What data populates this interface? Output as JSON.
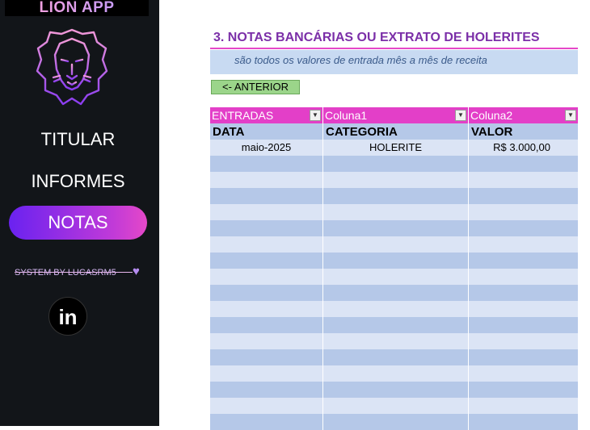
{
  "sidebar": {
    "app_title": "LION APP",
    "logo_icon": "lion-head-icon",
    "nav": [
      {
        "label": "TITULAR",
        "active": false
      },
      {
        "label": "INFORMES",
        "active": false
      },
      {
        "label": "NOTAS",
        "active": true
      }
    ],
    "credit": "SYSTEM BY LUCASRM5",
    "credit_icon": "heart-icon",
    "linkedin_label": "in"
  },
  "main": {
    "title": "3. NOTAS BANCÁRIAS OU EXTRATO DE HOLERITES",
    "subtitle": "são todos os valores de entrada mês a mês de receita",
    "back_button": "<- ANTERIOR"
  },
  "table": {
    "filter_headers": [
      "ENTRADAS",
      "Coluna1",
      "Coluna2"
    ],
    "columns": [
      "DATA",
      "CATEGORIA",
      "VALOR"
    ],
    "rows": [
      [
        "maio-2025",
        "HOLERITE",
        "R$ 3.000,00"
      ],
      [
        "",
        "",
        ""
      ],
      [
        "",
        "",
        ""
      ],
      [
        "",
        "",
        ""
      ],
      [
        "",
        "",
        ""
      ],
      [
        "",
        "",
        ""
      ],
      [
        "",
        "",
        ""
      ],
      [
        "",
        "",
        ""
      ],
      [
        "",
        "",
        ""
      ],
      [
        "",
        "",
        ""
      ],
      [
        "",
        "",
        ""
      ],
      [
        "",
        "",
        ""
      ],
      [
        "",
        "",
        ""
      ],
      [
        "",
        "",
        ""
      ],
      [
        "",
        "",
        ""
      ],
      [
        "",
        "",
        ""
      ],
      [
        "",
        "",
        ""
      ],
      [
        "",
        "",
        ""
      ]
    ]
  },
  "colors": {
    "sidebar_bg": "#121519",
    "accent_pink": "#e33fc8",
    "accent_purple": "#6a22f0",
    "title_purple": "#7b2fa8",
    "row_light": "#dbe4f5",
    "row_dark": "#b5c8e8",
    "button_green": "#9bd58a"
  }
}
